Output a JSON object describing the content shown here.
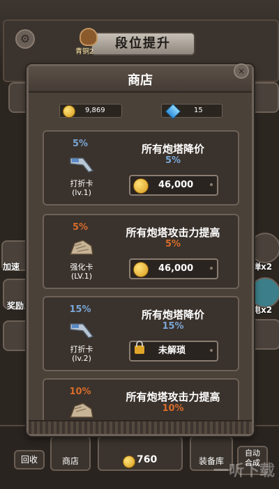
{
  "top": {
    "rank_button": "段位提升",
    "rank_label": "青铜2"
  },
  "side": {
    "left_speed": "加速",
    "left_reward": "奖励",
    "right_bullet": "弹x2",
    "right_electric": "电x2"
  },
  "shop": {
    "title": "商店",
    "coins": "9,869",
    "gems": "15",
    "items": [
      {
        "percent": "5%",
        "name_line1": "打折卡",
        "name_line2": "(lv.1)",
        "desc": "所有炮塔降价",
        "desc_percent": "5%",
        "price": "46,000",
        "locked": false
      },
      {
        "percent": "5%",
        "name_line1": "强化卡",
        "name_line2": "(LV.1)",
        "desc": "所有炮塔攻击力提高",
        "desc_percent": "5%",
        "price": "46,000",
        "locked": false
      },
      {
        "percent": "15%",
        "name_line1": "打折卡",
        "name_line2": "(lv.2)",
        "desc": "所有炮塔降价",
        "desc_percent": "15%",
        "price": "未解琐",
        "locked": true
      },
      {
        "percent": "10%",
        "desc": "所有炮塔攻击力提高",
        "desc_percent": "10%"
      }
    ]
  },
  "bottom": {
    "recycle": "回收",
    "shop": "商店",
    "coins": "760",
    "equipment": "装备库",
    "auto_merge_1": "自动",
    "auto_merge_2": "合成"
  },
  "watermark": "一听下载"
}
